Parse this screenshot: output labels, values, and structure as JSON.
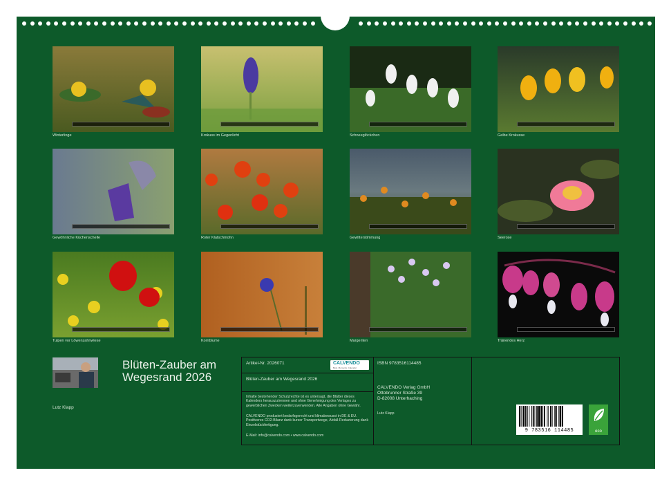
{
  "photos": [
    {
      "caption": "Winterlinge"
    },
    {
      "caption": "Krokuss im Gegenlicht"
    },
    {
      "caption": "Schneeglöckchen"
    },
    {
      "caption": "Gelbe Krokusse"
    },
    {
      "caption": "Gewöhnliche Küchenschelle"
    },
    {
      "caption": "Roter Klatschmohn"
    },
    {
      "caption": "Gewitterstimmung"
    },
    {
      "caption": "Seerose"
    },
    {
      "caption": "Tulpen vor Löwenzahnwiese"
    },
    {
      "caption": "Kornblume"
    },
    {
      "caption": "Margeriten"
    },
    {
      "caption": "Tränendes Herz"
    }
  ],
  "calendar": {
    "title_line1": "Blüten-Zauber am",
    "title_line2": "Wegesrand 2026",
    "author": "Lutz Klapp"
  },
  "info": {
    "article_label": "Artikel-Nr. 2026071",
    "logo_text": "CALVENDO",
    "logo_sub": "Best. Moments. Calendar",
    "title": "Blüten-Zauber am Wegesrand 2026",
    "rights_text": "Inhalte bestehender Schutzrechte ist es untersagt, die Blätter dieses Kalenders herauszutrennen und ohne Genehmigung des Verlages zu gewerblichen Zwecken weiterzuverwenden. Alle Angaben ohne Gewähr.",
    "eco_text": "CALVENDO produziert bedarfsgerecht und klimabewusst in DE & EU. Positiveres CO2-Bilanz dank kurzer Transportwege, Abfall-Reduzierung dank Einzelstückfertigung.",
    "contact": "E-Mail: info@calvendo.com • www.calvendo.com",
    "isbn": "ISBN 9783516114485",
    "publisher_line1": "CALVENDO Verlag GmbH",
    "publisher_line2": "Ottobrunner Straße 39",
    "publisher_line3": "D-82008 Unterhaching",
    "author_credit": "Lutz Klapp",
    "barcode_number": "9 783516 114485",
    "eco_label": "eco"
  }
}
